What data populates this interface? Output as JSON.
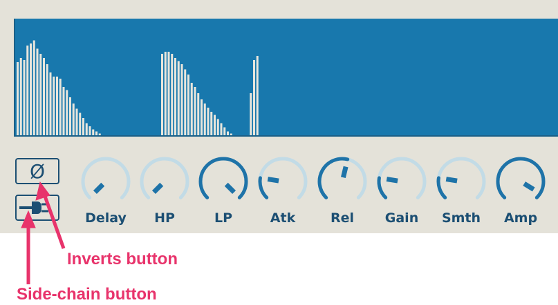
{
  "colors": {
    "panel_bg": "#e4e2d9",
    "display_bg": "#1878ad",
    "bars": "#e8e6dd",
    "knob_dark": "#1e73a8",
    "knob_light": "#c2dbe6",
    "label": "#1c4f73",
    "annotation": "#e8336b"
  },
  "spectrum": {
    "levels": [
      0.72,
      0.76,
      0.74,
      0.88,
      0.9,
      0.93,
      0.85,
      0.8,
      0.76,
      0.7,
      0.62,
      0.58,
      0.58,
      0.56,
      0.48,
      0.45,
      0.38,
      0.32,
      0.27,
      0.23,
      0.18,
      0.13,
      0.1,
      0.07,
      0.05,
      0.03,
      0,
      0,
      0,
      0,
      0,
      0,
      0,
      0,
      0,
      0,
      0,
      0,
      0,
      0,
      0,
      0,
      0,
      0,
      0.8,
      0.82,
      0.82,
      0.8,
      0.76,
      0.73,
      0.7,
      0.65,
      0.6,
      0.52,
      0.48,
      0.42,
      0.36,
      0.32,
      0.28,
      0.24,
      0.21,
      0.17,
      0.13,
      0.09,
      0.05,
      0.03,
      0,
      0,
      0,
      0,
      0,
      0.42,
      0.74,
      0.78
    ]
  },
  "buttons": {
    "invert": {
      "icon": "phase-invert-icon",
      "glyph": "Ø"
    },
    "sidechain": {
      "icon": "plug-icon"
    }
  },
  "knobs": [
    {
      "label": "Delay",
      "value": 0.0,
      "style": "light"
    },
    {
      "label": "HP",
      "value": 0.0,
      "style": "light"
    },
    {
      "label": "LP",
      "value": 1.0,
      "style": "dark"
    },
    {
      "label": "Atk",
      "value": 0.2,
      "style": "mixed"
    },
    {
      "label": "Rel",
      "value": 0.55,
      "style": "mixed"
    },
    {
      "label": "Gain",
      "value": 0.2,
      "style": "mixed"
    },
    {
      "label": "Smth",
      "value": 0.2,
      "style": "mixed"
    },
    {
      "label": "Amp",
      "value": 0.95,
      "style": "dark"
    }
  ],
  "annotations": {
    "invert": "Inverts button",
    "sidechain": "Side-chain button"
  }
}
